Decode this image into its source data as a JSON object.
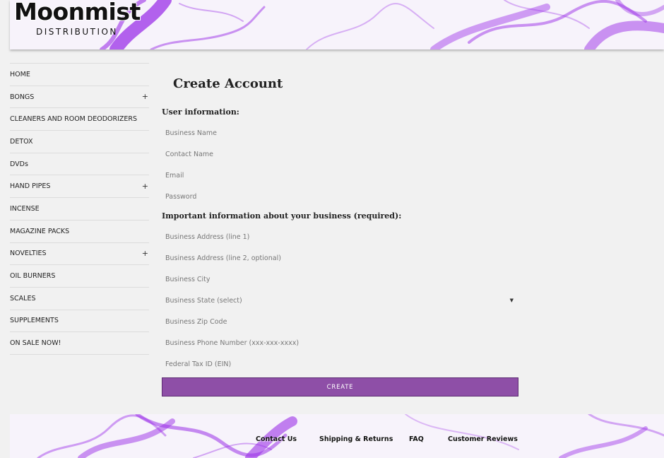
{
  "brand": {
    "name": "Moonmist",
    "tagline": "DISTRIBUTION"
  },
  "colors": {
    "accent": "#8e4fa7",
    "smoke": "#9b30e8",
    "background": "#f1f1f1"
  },
  "sidebar": {
    "items": [
      {
        "label": "HOME",
        "expandable": false
      },
      {
        "label": "BONGS",
        "expandable": true
      },
      {
        "label": "CLEANERS AND ROOM DEODORIZERS",
        "expandable": false
      },
      {
        "label": "DETOX",
        "expandable": false
      },
      {
        "label": "DVDs",
        "expandable": false
      },
      {
        "label": "HAND PIPES",
        "expandable": true
      },
      {
        "label": "INCENSE",
        "expandable": false
      },
      {
        "label": "MAGAZINE PACKS",
        "expandable": false
      },
      {
        "label": "NOVELTIES",
        "expandable": true
      },
      {
        "label": "OIL BURNERS",
        "expandable": false
      },
      {
        "label": "SCALES",
        "expandable": false
      },
      {
        "label": "SUPPLEMENTS",
        "expandable": false
      },
      {
        "label": "ON SALE NOW!",
        "expandable": false
      }
    ],
    "expand_symbol": "+"
  },
  "form": {
    "title": "Create Account",
    "user_section": "User information:",
    "business_section": "Important information about your business (required):",
    "fields": {
      "business_name": "Business Name",
      "contact_name": "Contact Name",
      "email": "Email",
      "password": "Password",
      "address1": "Business Address (line 1)",
      "address2": "Business Address (line 2, optional)",
      "city": "Business City",
      "state": "Business State (select)",
      "zip": "Business Zip Code",
      "phone": "Business Phone Number (xxx-xxx-xxxx)",
      "tax_id": "Federal Tax ID (EIN)"
    },
    "submit_label": "CREATE"
  },
  "footer": {
    "links": [
      "Contact Us",
      "Shipping & Returns",
      "FAQ",
      "Customer Reviews"
    ]
  }
}
